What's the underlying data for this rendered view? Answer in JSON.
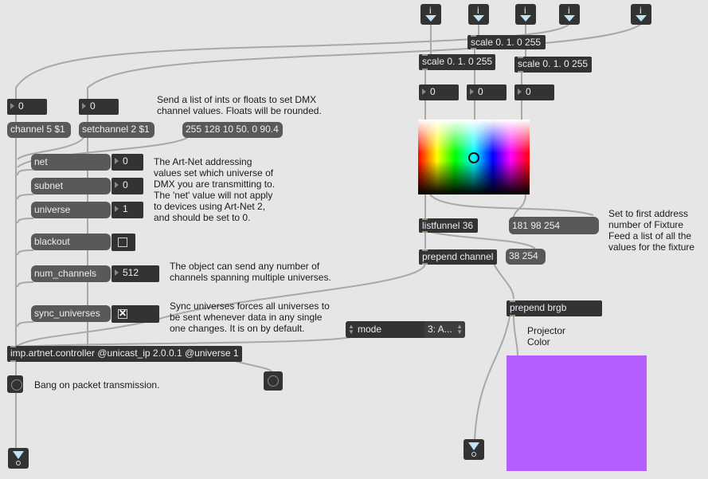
{
  "inlets": [
    {
      "label": "i"
    },
    {
      "label": "i"
    },
    {
      "label": "i"
    },
    {
      "label": "i"
    },
    {
      "label": "i"
    }
  ],
  "scale_objects": {
    "top": "scale 0. 1. 0 255",
    "left": "scale 0. 1. 0 255",
    "right": "scale 0. 1. 0 255"
  },
  "number_boxes": {
    "rgb_r": "0",
    "rgb_g": "0",
    "rgb_b": "0",
    "channel_num": "0",
    "setchannel_num": "0",
    "net": "0",
    "subnet": "0",
    "universe": "1",
    "num_channels": "512"
  },
  "messages": {
    "channel": "channel 5 $1",
    "setchannel": "setchannel 2 $1",
    "list": "255 128 10 50. 0 90.4",
    "net": "net",
    "subnet": "subnet",
    "universe": "universe",
    "blackout": "blackout",
    "num_channels": "num_channels",
    "sync_universes": "sync_universes",
    "rgb_list": "181 98 254",
    "prepend_out": "38 254"
  },
  "objects": {
    "listfunnel": "listfunnel 36",
    "prepend_channel": "prepend channel",
    "prepend_brgb": "prepend brgb",
    "controller": "imp.artnet.controller @unicast_ip 2.0.0.1 @universe 1"
  },
  "attrui": {
    "label": "mode",
    "value": "3: A..."
  },
  "toggles": {
    "blackout": false,
    "sync_universes": true
  },
  "comments": {
    "send_list": "Send a list of ints or floats to set DMX\nchannel values. Floats will be rounded.",
    "artnet": "The Art-Net addressing\nvalues set which universe of\nDMX you are transmitting to.\nThe 'net' value will not apply\nto devices using Art-Net 2,\nand should be set to 0.",
    "num_channels": "The object can send any number of\nchannels spanning multiple universes.",
    "sync": "Sync universes forces all universes to\nbe sent whenever data in any single\none changes. It is on by default.",
    "bang": "Bang on packet transmission.",
    "fixture": "Set to first address\nnumber of Fixture\nFeed a list of all the\nvalues for the fixture",
    "projector": "Projector\nColor"
  },
  "colors": {
    "background": "#e6e6e6",
    "projector_color": "#b55efe",
    "inlet_arrow": "#bfe3f5",
    "patch_cord": "#a8a8a8"
  }
}
